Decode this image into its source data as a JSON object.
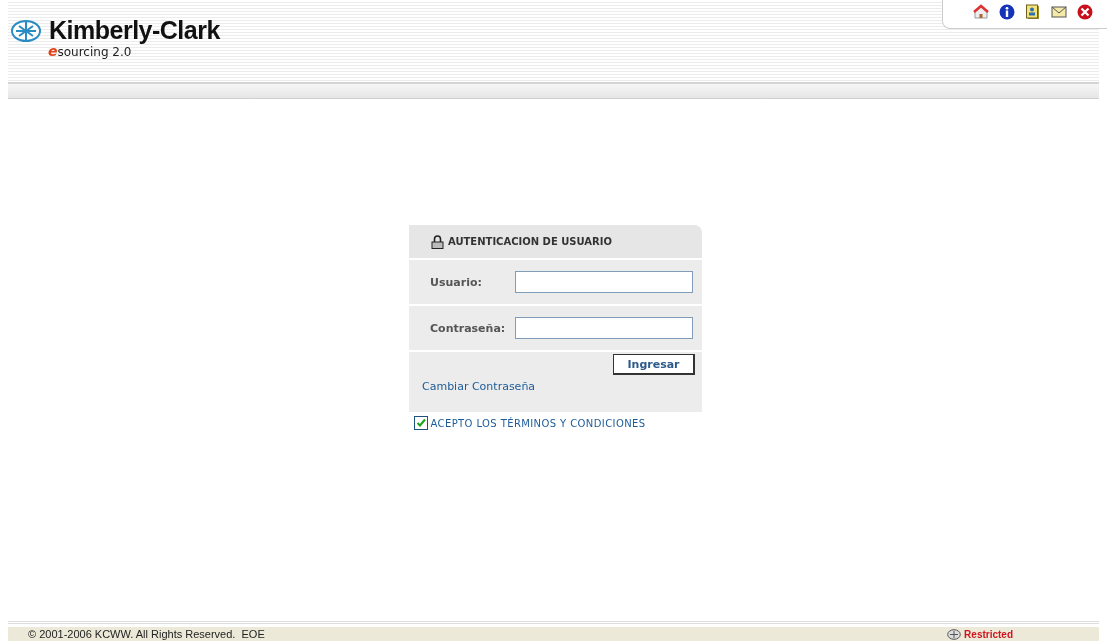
{
  "header": {
    "brand": "Kimberly-Clark",
    "product_mark": "e",
    "product": "sourcing 2.0"
  },
  "login": {
    "title": "AUTENTICACION DE USUARIO",
    "fields": [
      {
        "label": "Usuario:"
      },
      {
        "label": "Contraseña:"
      }
    ],
    "button": "Ingresar",
    "link": "Cambiar Contraseña"
  },
  "terms": {
    "label": "ACEPTO LOS TÉRMINOS Y CONDICIONES",
    "checked": true
  },
  "footer": {
    "copyright": "© 2001-2006 KCWW. All Rights Reserved.  EOE",
    "classification": "Restricted"
  }
}
